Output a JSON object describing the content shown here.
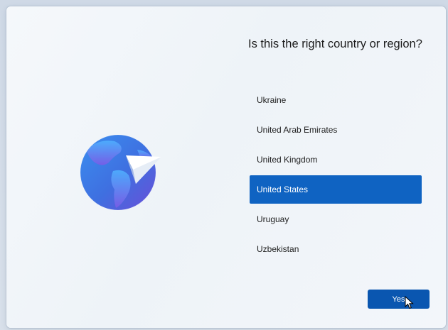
{
  "page": {
    "title": "Is this the right country or region?"
  },
  "countries": [
    {
      "label": "Ukraine",
      "selected": false
    },
    {
      "label": "United Arab Emirates",
      "selected": false
    },
    {
      "label": "United Kingdom",
      "selected": false
    },
    {
      "label": "United States",
      "selected": true
    },
    {
      "label": "Uruguay",
      "selected": false
    },
    {
      "label": "Uzbekistan",
      "selected": false
    }
  ],
  "actions": {
    "yes_label": "Yes"
  },
  "colors": {
    "selected_background": "#0f63c2",
    "button_background": "#0a56b0"
  },
  "icons": {
    "illustration": "globe-paper-plane-icon",
    "pointer": "mouse-pointer-icon"
  }
}
